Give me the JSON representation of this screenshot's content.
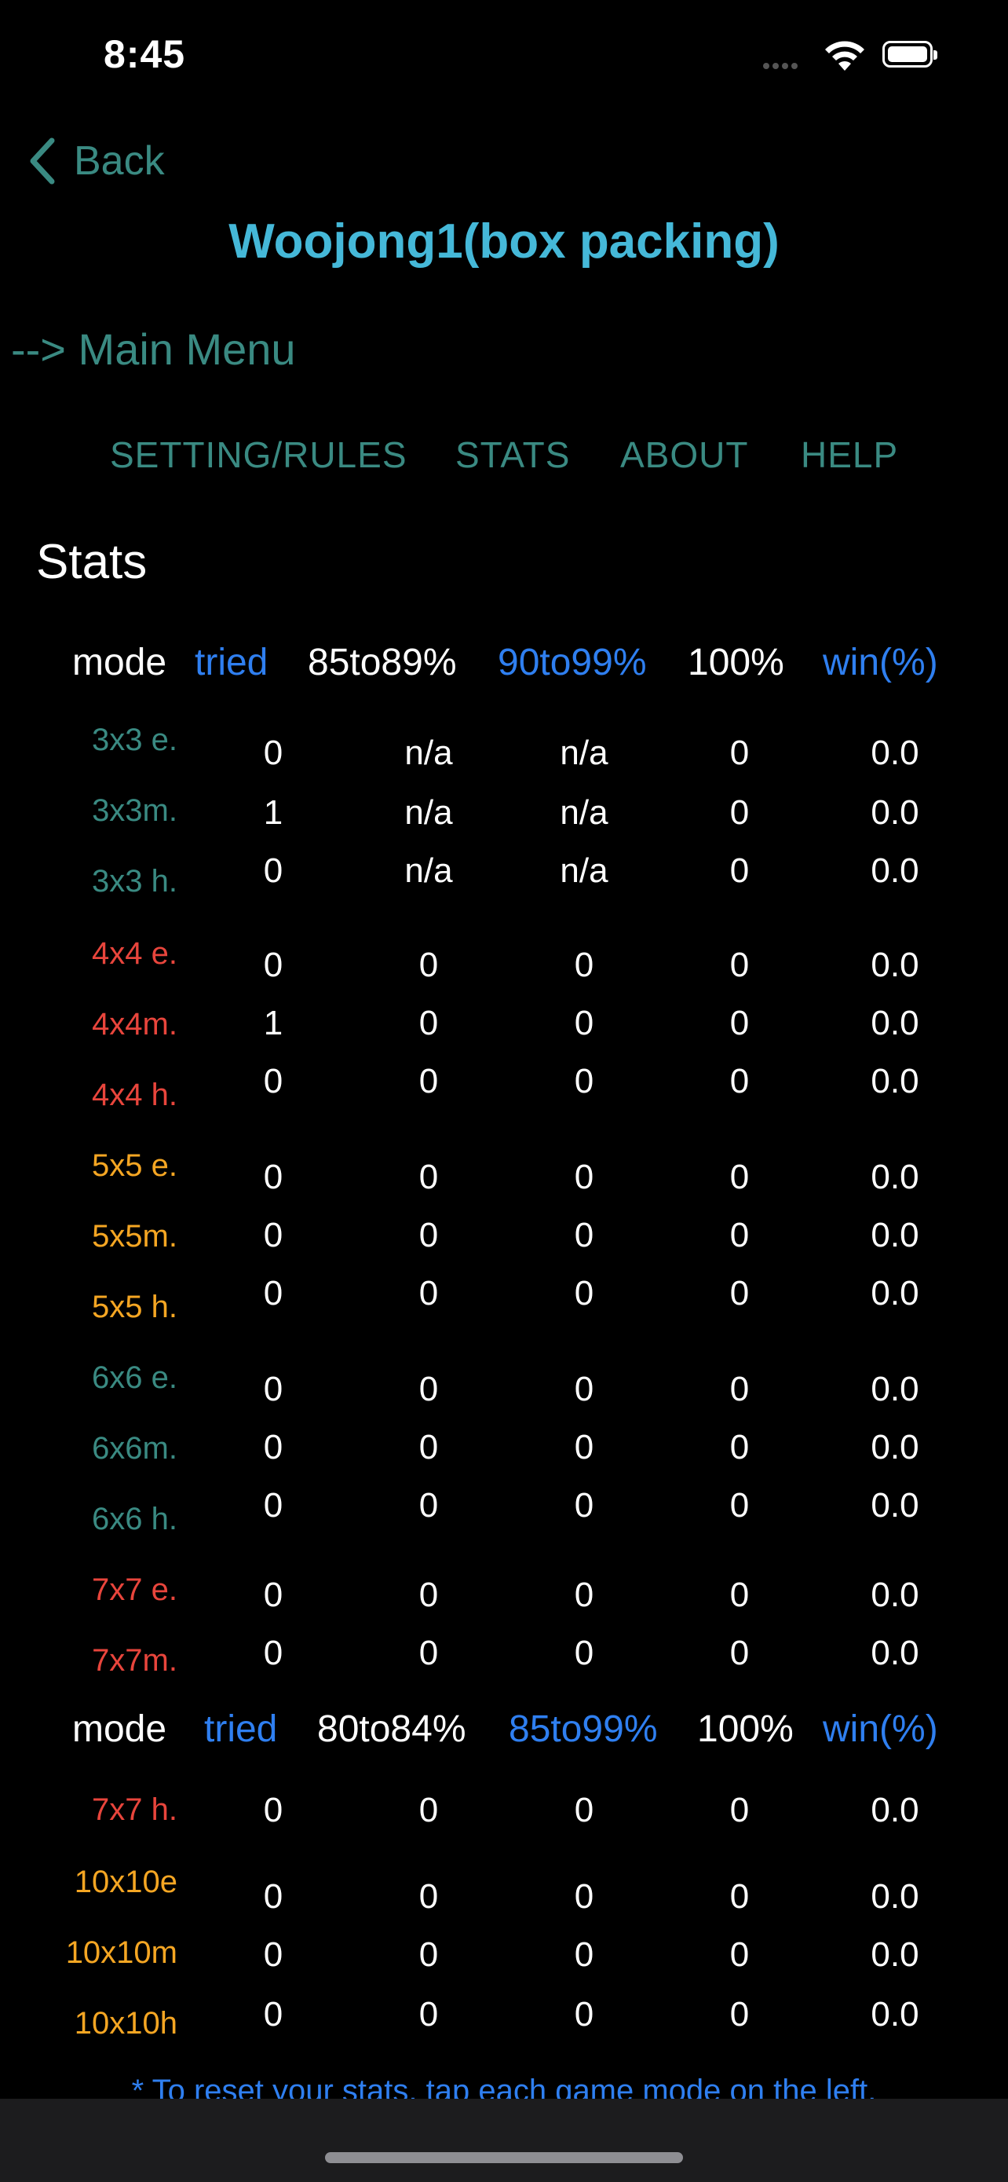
{
  "status_bar": {
    "time": "8:45"
  },
  "nav": {
    "back_label": "Back",
    "title": "Woojong1(box packing)",
    "main_menu": "--> Main Menu"
  },
  "tabs": [
    "SETTING/RULES",
    "STATS",
    "ABOUT",
    "HELP"
  ],
  "section_title": "Stats",
  "colors": {
    "teal": "#3a8a82",
    "red": "#e8453c",
    "orange": "#f5a623",
    "blue": "#2f7ff0",
    "title": "#45b8d8"
  },
  "table1": {
    "headers": [
      "mode",
      "tried",
      "85to89%",
      "90to99%",
      "100%",
      "win(%)"
    ],
    "rows": [
      {
        "mode": "3x3 e.",
        "color": "teal",
        "values": [
          "0",
          "n/a",
          "n/a",
          "0",
          "0.0"
        ]
      },
      {
        "mode": "3x3m.",
        "color": "teal",
        "values": [
          "1",
          "n/a",
          "n/a",
          "0",
          "0.0"
        ]
      },
      {
        "mode": "3x3 h.",
        "color": "teal",
        "values": [
          "0",
          "n/a",
          "n/a",
          "0",
          "0.0"
        ]
      },
      {
        "mode": "4x4 e.",
        "color": "red",
        "values": [
          "0",
          "0",
          "0",
          "0",
          "0.0"
        ]
      },
      {
        "mode": "4x4m.",
        "color": "red",
        "values": [
          "1",
          "0",
          "0",
          "0",
          "0.0"
        ]
      },
      {
        "mode": "4x4 h.",
        "color": "red",
        "values": [
          "0",
          "0",
          "0",
          "0",
          "0.0"
        ]
      },
      {
        "mode": "5x5 e.",
        "color": "orange",
        "values": [
          "0",
          "0",
          "0",
          "0",
          "0.0"
        ]
      },
      {
        "mode": "5x5m.",
        "color": "orange",
        "values": [
          "0",
          "0",
          "0",
          "0",
          "0.0"
        ]
      },
      {
        "mode": "5x5 h.",
        "color": "orange",
        "values": [
          "0",
          "0",
          "0",
          "0",
          "0.0"
        ]
      },
      {
        "mode": "6x6 e.",
        "color": "teal",
        "values": [
          "0",
          "0",
          "0",
          "0",
          "0.0"
        ]
      },
      {
        "mode": "6x6m.",
        "color": "teal",
        "values": [
          "0",
          "0",
          "0",
          "0",
          "0.0"
        ]
      },
      {
        "mode": "6x6 h.",
        "color": "teal",
        "values": [
          "0",
          "0",
          "0",
          "0",
          "0.0"
        ]
      },
      {
        "mode": "7x7 e.",
        "color": "red",
        "values": [
          "0",
          "0",
          "0",
          "0",
          "0.0"
        ]
      },
      {
        "mode": "7x7m.",
        "color": "red",
        "values": [
          "0",
          "0",
          "0",
          "0",
          "0.0"
        ]
      }
    ]
  },
  "table2": {
    "headers": [
      "mode",
      "tried",
      "80to84%",
      "85to99%",
      "100%",
      "win(%)"
    ],
    "rows": [
      {
        "mode": "7x7 h.",
        "color": "red",
        "values": [
          "0",
          "0",
          "0",
          "0",
          "0.0"
        ]
      },
      {
        "mode": "10x10e",
        "color": "orange",
        "values": [
          "0",
          "0",
          "0",
          "0",
          "0.0"
        ]
      },
      {
        "mode": "10x10m",
        "color": "orange",
        "values": [
          "0",
          "0",
          "0",
          "0",
          "0.0"
        ]
      },
      {
        "mode": "10x10h",
        "color": "orange",
        "values": [
          "0",
          "0",
          "0",
          "0",
          "0.0"
        ]
      }
    ]
  },
  "footer_note": "* To reset your stats, tap each game mode on the left."
}
